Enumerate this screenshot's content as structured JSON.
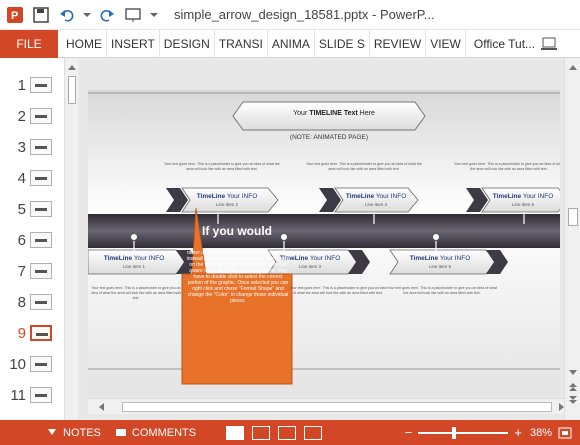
{
  "window": {
    "title": "simple_arrow_design_18581.pptx - PowerP..."
  },
  "ribbon": {
    "file": "FILE",
    "tabs": [
      "HOME",
      "INSERT",
      "DESIGN",
      "TRANSI",
      "ANIMA",
      "SLIDE S",
      "REVIEW",
      "VIEW"
    ],
    "account": "Office Tut..."
  },
  "thumbnails": [
    "1",
    "2",
    "3",
    "4",
    "5",
    "6",
    "7",
    "8",
    "9",
    "10",
    "11"
  ],
  "active_thumbnail": "9",
  "slide": {
    "header_title_prefix": "Your ",
    "header_title_bold": "TIMELINE Text",
    "header_title_suffix": " Here",
    "subtitle": "(NOTE: ANIMATED PAGE)",
    "placeholder_text": "Your text goes here. This is a placeholder to give you an idea of what the area will look like with an area filled with text.",
    "items": [
      {
        "title_bold": "TimeLine",
        "title_rest": " Your INFO",
        "sub": "Line item 1"
      },
      {
        "title_bold": "TimeLine",
        "title_rest": " Your INFO",
        "sub": "Line item 2"
      },
      {
        "title_bold": "TimeLine",
        "title_rest": " Your INFO",
        "sub": "Line item 3"
      },
      {
        "title_bold": "TimeLine",
        "title_rest": " Your INFO",
        "sub": "Line item 4"
      },
      {
        "title_bold": "TimeLine",
        "title_rest": " Your INFO",
        "sub": "Line item 5"
      },
      {
        "title_bold": "TimeLine",
        "title_rest": " Your INFO",
        "sub": "Line item 6"
      }
    ],
    "callout": {
      "heading": "If you would",
      "body": "rather change the color of each individual item instead of the entire theme color as mentioned on the first page. You can select an item (be aware some items are grouped) so you may have to double click to select the correct portion of the graphic. Once selected you can right click and chose \"Format Shape\" and change the \"Color\" to change those individual pieces."
    }
  },
  "status": {
    "notes": "NOTES",
    "comments": "COMMENTS",
    "zoom": "38%"
  },
  "colors": {
    "accent": "#d24726",
    "callout": "#e8722a",
    "dark_band": "#3d3a44"
  }
}
